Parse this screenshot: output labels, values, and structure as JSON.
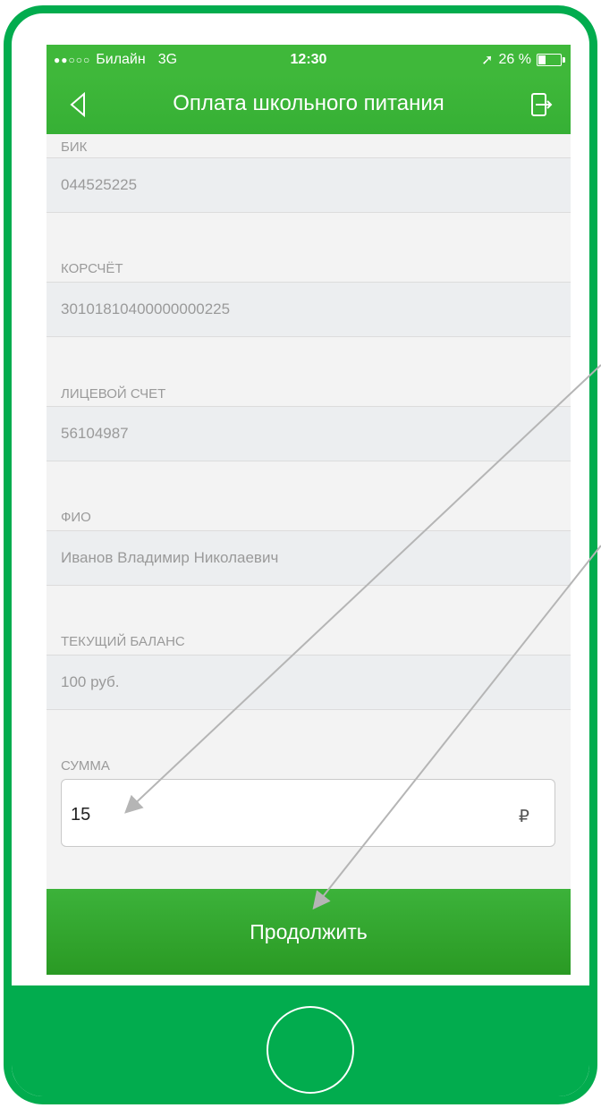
{
  "status_bar": {
    "carrier": "Билайн",
    "network": "3G",
    "time": "12:30",
    "battery": "26 %"
  },
  "nav": {
    "title": "Оплата школьного питания",
    "back_icon": "chevron-left-icon",
    "exit_icon": "logout-icon"
  },
  "fields": [
    {
      "label": "БИК",
      "value": "044525225"
    },
    {
      "label": "КОРСЧЁТ",
      "value": "30101810400000000225"
    },
    {
      "label": "ЛИЦЕВОЙ СЧЕТ",
      "value": "56104987"
    },
    {
      "label": "ФИО",
      "value": "Иванов Владимир Николаевич"
    },
    {
      "label": "ТЕКУЩИЙ БАЛАНС",
      "value": "100 руб."
    }
  ],
  "amount": {
    "label": "СУММА",
    "value": "15",
    "currency": "₽"
  },
  "continue_label": "Продолжить",
  "colors": {
    "brand_green": "#3fb83a",
    "frame_green": "#02ac4e"
  }
}
